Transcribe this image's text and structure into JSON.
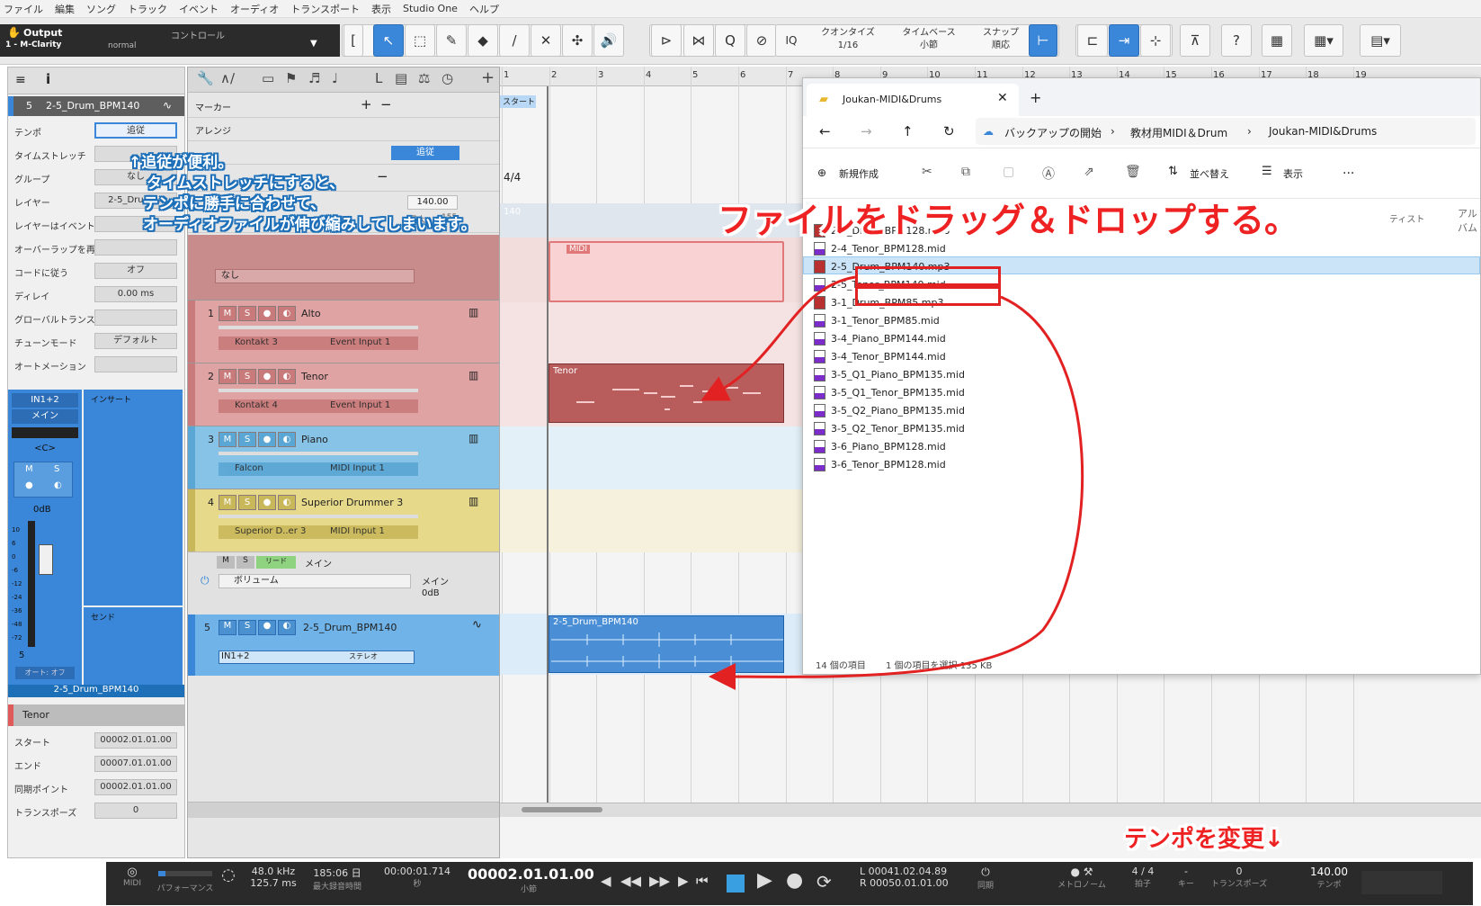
{
  "menu": [
    "ファイル",
    "編集",
    "ソング",
    "トラック",
    "イベント",
    "オーディオ",
    "トランスポート",
    "表示",
    "Studio One",
    "ヘルプ"
  ],
  "output": {
    "title": "Output",
    "device": "1 - M-Clarity",
    "mode": "normal",
    "control": "コントロール"
  },
  "quantize": {
    "q_label": "クオンタイズ",
    "q_value": "1/16",
    "tb_label": "タイムベース",
    "tb_value": "小節",
    "snap_label": "スナップ",
    "snap_value": "順応",
    "iq": "IQ"
  },
  "inspector": {
    "track_num": "5",
    "track_name": "2-5_Drum_BPM140",
    "rows": [
      {
        "label": "テンポ",
        "value": "追従"
      },
      {
        "label": "タイムストレッチ",
        "value": ""
      },
      {
        "label": "グループ",
        "value": "なし"
      },
      {
        "label": "レイヤー",
        "value": "2-5_Dru...4.."
      },
      {
        "label": "レイヤーはイベントに従う",
        "value": ""
      },
      {
        "label": "オーバーラップを再生",
        "value": ""
      },
      {
        "label": "コードに従う",
        "value": "オフ"
      },
      {
        "label": "ディレイ",
        "value": "0.00 ms"
      },
      {
        "label": "グローバルトランスポーズに従う",
        "value": ""
      },
      {
        "label": "チューンモード",
        "value": "デフォルト"
      },
      {
        "label": "オートメーション",
        "value": ""
      }
    ],
    "input": "IN1+2",
    "main": "メイン",
    "pan": "<C>",
    "insert": "インサート",
    "send": "センド",
    "vol": "0dB",
    "ch_num": "5",
    "auto": "オート: オフ",
    "ch_name": "2-5_Drum_BPM140",
    "fader_scale": [
      "10",
      "6",
      "0",
      "-6",
      "-12",
      "-24",
      "-36",
      "-48",
      "-72"
    ],
    "event_title": "Tenor",
    "event_rows": [
      {
        "label": "スタート",
        "value": "00002.01.01.00"
      },
      {
        "label": "エンド",
        "value": "00007.01.01.00"
      },
      {
        "label": "同期ポイント",
        "value": "00002.01.01.00"
      },
      {
        "label": "トランスポーズ",
        "value": "0"
      }
    ]
  },
  "global": {
    "marker": "マーカー",
    "arrange": "アレンジ",
    "follow": "追従",
    "sig": "4/4",
    "tempo": "140.00",
    "max": "最大",
    "max_val": "155"
  },
  "tracks": [
    {
      "num": "1",
      "name": "Alto",
      "inst": "Kontakt 3",
      "input": "Event Input 1"
    },
    {
      "num": "2",
      "name": "Tenor",
      "inst": "Kontakt 4",
      "input": "Event Input 1"
    },
    {
      "num": "3",
      "name": "Piano",
      "inst": "Falcon",
      "input": "MIDI Input 1"
    },
    {
      "num": "4",
      "name": "Superior Drummer 3",
      "inst": "Superior D..er 3",
      "input": "MIDI Input 1"
    }
  ],
  "folder": {
    "preset": "なし",
    "read": "リード",
    "main": "メイン",
    "param": "ボリューム",
    "out": "メイン",
    "out_vol": "0dB"
  },
  "audio_track": {
    "num": "5",
    "name": "2-5_Drum_BPM140",
    "input": "IN1+2",
    "mode": "ステレオ"
  },
  "ruler": [
    "1",
    "2",
    "3",
    "4",
    "5",
    "6",
    "7",
    "8",
    "9",
    "10",
    "11",
    "12",
    "13",
    "14",
    "15",
    "16",
    "17",
    "18",
    "19"
  ],
  "start_marker": "スタート",
  "events": {
    "midi_label": "MIDI",
    "tenor": "Tenor",
    "drum": "2-5_Drum_BPM140",
    "tempo_lane": "140"
  },
  "explorer": {
    "tab_title": "Joukan-MIDI&Drums",
    "crumbs": [
      "バックアップの開始",
      "教材用MIDI＆Drum",
      "Joukan-MIDI&Drums"
    ],
    "new": "新規作成",
    "sort": "並べ替え",
    "view": "表示",
    "more": "...",
    "col_album": "アルバム",
    "col_artist": "ティスト",
    "files": [
      {
        "name": "2-4_Drum_BPM128.mp3",
        "type": "mp3"
      },
      {
        "name": "2-4_Tenor_BPM128.mid",
        "type": "mid"
      },
      {
        "name": "2-5_Drum_BPM140.mp3",
        "type": "mp3"
      },
      {
        "name": "2-5_Tenor_BPM140.mid",
        "type": "mid"
      },
      {
        "name": "3-1_Drum_BPM85.mp3",
        "type": "mp3"
      },
      {
        "name": "3-1_Tenor_BPM85.mid",
        "type": "mid"
      },
      {
        "name": "3-4_Piano_BPM144.mid",
        "type": "mid"
      },
      {
        "name": "3-4_Tenor_BPM144.mid",
        "type": "mid"
      },
      {
        "name": "3-5_Q1_Piano_BPM135.mid",
        "type": "mid"
      },
      {
        "name": "3-5_Q1_Tenor_BPM135.mid",
        "type": "mid"
      },
      {
        "name": "3-5_Q2_Piano_BPM135.mid",
        "type": "mid"
      },
      {
        "name": "3-5_Q2_Tenor_BPM135.mid",
        "type": "mid"
      },
      {
        "name": "3-6_Piano_BPM128.mid",
        "type": "mid"
      },
      {
        "name": "3-6_Tenor_BPM128.mid",
        "type": "mid"
      }
    ],
    "status_count": "14 個の項目",
    "status_sel": "1 個の項目を選択  135 KB"
  },
  "annotations": {
    "note1_l1": "↑追従が便利。",
    "note1_l2": "タイムストレッチにすると、",
    "note1_l3": "テンポに勝手に合わせて、",
    "note1_l4": "オーディオファイルが伸び縮みしてしまいます。",
    "drag": "ファイルをドラッグ＆ドロップする。",
    "tempo_change": "テンポを変更↓"
  },
  "transport": {
    "midi": "MIDI",
    "perf": "パフォーマンス",
    "rate": "48.0 kHz",
    "latency": "125.7 ms",
    "rec": "185:06 日",
    "rec_sub": "最大録音時間",
    "time": "00:00:01.714",
    "time_sub": "秒",
    "bars": "00002.01.01.00",
    "bars_sub": "小節",
    "loop_l": "00041.02.04.89",
    "loop_r": "00050.01.01.00",
    "sync": "同期",
    "metro": "メトロノーム",
    "sig": "4 / 4",
    "sig_sub": "拍子",
    "key": "-",
    "key_sub": "キー",
    "transpose": "0",
    "transpose_sub": "トランスポーズ",
    "tempo": "140.00",
    "tempo_sub": "テンポ"
  },
  "colors": {
    "accent": "#3a86d8",
    "red_annot": "#e22222",
    "note_blue": "#1d6fb8",
    "midi_event": "#b85c5c",
    "audio_event": "#4a8fd6"
  }
}
